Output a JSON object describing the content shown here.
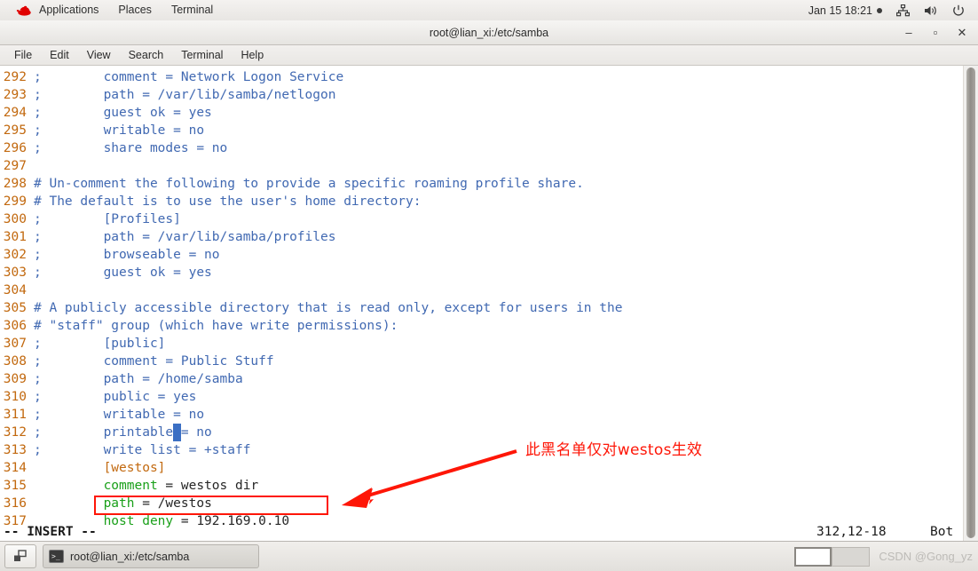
{
  "top_panel": {
    "logo": "redhat-logo",
    "menus": [
      "Applications",
      "Places",
      "Terminal"
    ],
    "clock": "Jan 15  18:21",
    "indicators": [
      "recording-dot",
      "network-icon",
      "volume-icon",
      "power-icon"
    ]
  },
  "window": {
    "title": "root@lian_xi:/etc/samba",
    "buttons": {
      "minimize": "–",
      "maximize": "▫",
      "close": "✕"
    },
    "menubar": [
      "File",
      "Edit",
      "View",
      "Search",
      "Terminal",
      "Help"
    ]
  },
  "editor": {
    "mode_line": "-- INSERT --",
    "position": "312,12-18",
    "scroll_state": "Bot",
    "cursor_line": 312,
    "lines": [
      {
        "n": "292",
        "parts": [
          {
            "t": ";        comment = Network Logon Service",
            "c": "cmt"
          }
        ]
      },
      {
        "n": "293",
        "parts": [
          {
            "t": ";        path = /var/lib/samba/netlogon",
            "c": "cmt"
          }
        ]
      },
      {
        "n": "294",
        "parts": [
          {
            "t": ";        guest ok = yes",
            "c": "cmt"
          }
        ]
      },
      {
        "n": "295",
        "parts": [
          {
            "t": ";        writable = no",
            "c": "cmt"
          }
        ]
      },
      {
        "n": "296",
        "parts": [
          {
            "t": ";        share modes = no",
            "c": "cmt"
          }
        ]
      },
      {
        "n": "297",
        "parts": []
      },
      {
        "n": "298",
        "parts": [
          {
            "t": "# Un-comment the following to provide a specific roaming profile share.",
            "c": "cmt"
          }
        ]
      },
      {
        "n": "299",
        "parts": [
          {
            "t": "# The default is to use the user's home directory:",
            "c": "cmt"
          }
        ]
      },
      {
        "n": "300",
        "parts": [
          {
            "t": ";        [Profiles]",
            "c": "cmt"
          }
        ]
      },
      {
        "n": "301",
        "parts": [
          {
            "t": ";        path = /var/lib/samba/profiles",
            "c": "cmt"
          }
        ]
      },
      {
        "n": "302",
        "parts": [
          {
            "t": ";        browseable = no",
            "c": "cmt"
          }
        ]
      },
      {
        "n": "303",
        "parts": [
          {
            "t": ";        guest ok = yes",
            "c": "cmt"
          }
        ]
      },
      {
        "n": "304",
        "parts": []
      },
      {
        "n": "305",
        "parts": [
          {
            "t": "# A publicly accessible directory that is read only, except for users in the",
            "c": "cmt"
          }
        ]
      },
      {
        "n": "306",
        "parts": [
          {
            "t": "# \"staff\" group (which have write permissions):",
            "c": "cmt"
          }
        ]
      },
      {
        "n": "307",
        "parts": [
          {
            "t": ";        [public]",
            "c": "cmt"
          }
        ]
      },
      {
        "n": "308",
        "parts": [
          {
            "t": ";        comment = Public Stuff",
            "c": "cmt"
          }
        ]
      },
      {
        "n": "309",
        "parts": [
          {
            "t": ";        path = /home/samba",
            "c": "cmt"
          }
        ]
      },
      {
        "n": "310",
        "parts": [
          {
            "t": ";        public = yes",
            "c": "cmt"
          }
        ]
      },
      {
        "n": "311",
        "parts": [
          {
            "t": ";        writable = no",
            "c": "cmt"
          }
        ]
      },
      {
        "n": "312",
        "parts": [
          {
            "t": ";        printable",
            "c": "cmt"
          },
          {
            "t": " ",
            "c": "cursor"
          },
          {
            "t": "= no",
            "c": "cmt"
          }
        ]
      },
      {
        "n": "313",
        "parts": [
          {
            "t": ";        write list = +staff",
            "c": "cmt"
          }
        ]
      },
      {
        "n": "314",
        "parts": [
          {
            "t": "         [westos]",
            "c": "sec"
          }
        ]
      },
      {
        "n": "315",
        "parts": [
          {
            "t": "         comment",
            "c": "key"
          },
          {
            "t": " = westos dir",
            "c": "val"
          }
        ]
      },
      {
        "n": "316",
        "parts": [
          {
            "t": "         path",
            "c": "key"
          },
          {
            "t": " = /westos",
            "c": "val"
          }
        ]
      },
      {
        "n": "317",
        "parts": [
          {
            "t": "         host deny",
            "c": "key"
          },
          {
            "t": " = 192.169.0.10",
            "c": "val"
          }
        ]
      }
    ]
  },
  "annotations": {
    "note_text": "此黑名单仅对westos生效",
    "note_color": "#fe1607",
    "highlight_box_color": "#fe1607",
    "arrow": "red-arrow-pointing-left"
  },
  "taskbar": {
    "show_desktop": "show-desktop-icon",
    "task_label": "root@lian_xi:/etc/samba",
    "task_icon": "terminal-icon",
    "workspaces": [
      "workspace-1-active",
      "workspace-2"
    ],
    "watermark": "CSDN @Gong_yz"
  }
}
